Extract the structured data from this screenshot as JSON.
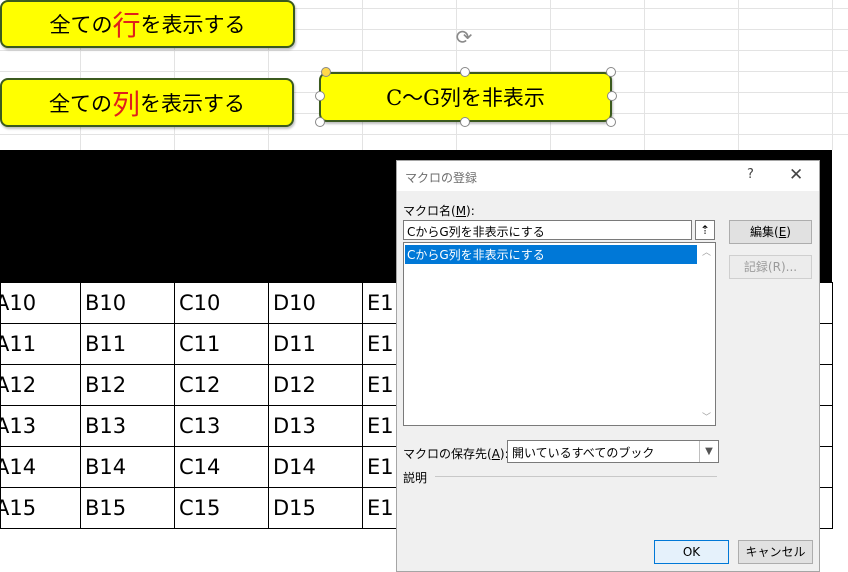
{
  "buttons": {
    "show_rows": {
      "pre": "全ての",
      "accent": "行",
      "post": "を表示する"
    },
    "show_cols": {
      "pre": "全ての",
      "accent": "列",
      "post": "を表示する"
    },
    "hide_cols": {
      "label": "C～G列を非表示"
    }
  },
  "colors": {
    "accent": "#e0201b",
    "shape_fill": "#ffff00",
    "selection": "#0078d7"
  },
  "table": {
    "rows": [
      [
        "A10",
        "B10",
        "C10",
        "D10",
        "E1"
      ],
      [
        "A11",
        "B11",
        "C11",
        "D11",
        "E1"
      ],
      [
        "A12",
        "B12",
        "C12",
        "D12",
        "E1"
      ],
      [
        "A13",
        "B13",
        "C13",
        "D13",
        "E1"
      ],
      [
        "A14",
        "B14",
        "C14",
        "D14",
        "E1"
      ],
      [
        "A15",
        "B15",
        "C15",
        "D15",
        "E1"
      ]
    ]
  },
  "dialog": {
    "title": "マクロの登録",
    "help": "?",
    "close": "✕",
    "macro_name_label": "マクロ名(",
    "macro_name_key": "M",
    "macro_name_label_end": "):",
    "macro_name_value": "CからG列を非表示にする",
    "list_items": [
      "CからG列を非表示にする"
    ],
    "edit_button": "編集(",
    "edit_key": "E",
    "edit_end": ")",
    "record_button": "記録(R)...",
    "store_label": "マクロの保存先(",
    "store_key": "A",
    "store_label_end": "):",
    "store_value": "開いているすべてのブック",
    "description_label": "説明",
    "ok_button": "OK",
    "cancel_button": "キャンセル"
  }
}
